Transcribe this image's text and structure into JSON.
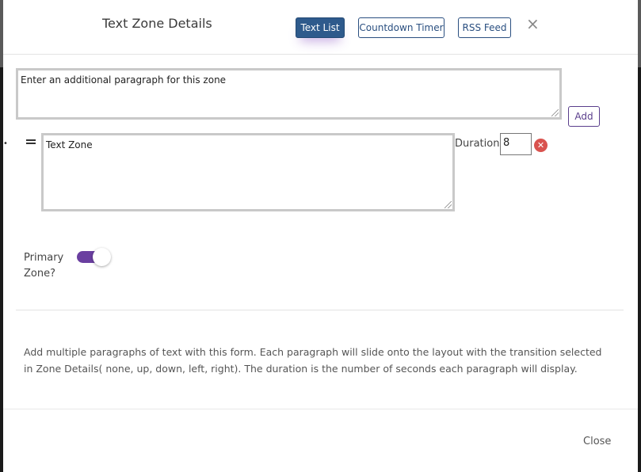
{
  "modal": {
    "title": "Text Zone Details",
    "close_symbol": "×"
  },
  "tabs": [
    {
      "label": "Text List",
      "active": true
    },
    {
      "label": "Countdown Timer",
      "active": false
    },
    {
      "label": "RSS Feed",
      "active": false
    }
  ],
  "new_paragraph": {
    "placeholder": "Enter an additional paragraph for this zone",
    "add_label": "Add"
  },
  "paragraphs": [
    {
      "text": "Text Zone",
      "duration_label": "Duration",
      "duration": "8"
    }
  ],
  "primary_zone": {
    "label_line1": "Primary",
    "label_line2": "Zone?",
    "checked": true
  },
  "help_text": "Add multiple paragraphs of text with this form. Each paragraph will slide onto the layout with the transition selected in Zone Details( none, up, down, left, right). The duration is the number of seconds each paragraph will display.",
  "footer": {
    "close_label": "Close"
  },
  "colors": {
    "accent_purple": "#6a3fa0",
    "active_tab": "#2e5a8c",
    "remove_red": "#d9534f"
  }
}
